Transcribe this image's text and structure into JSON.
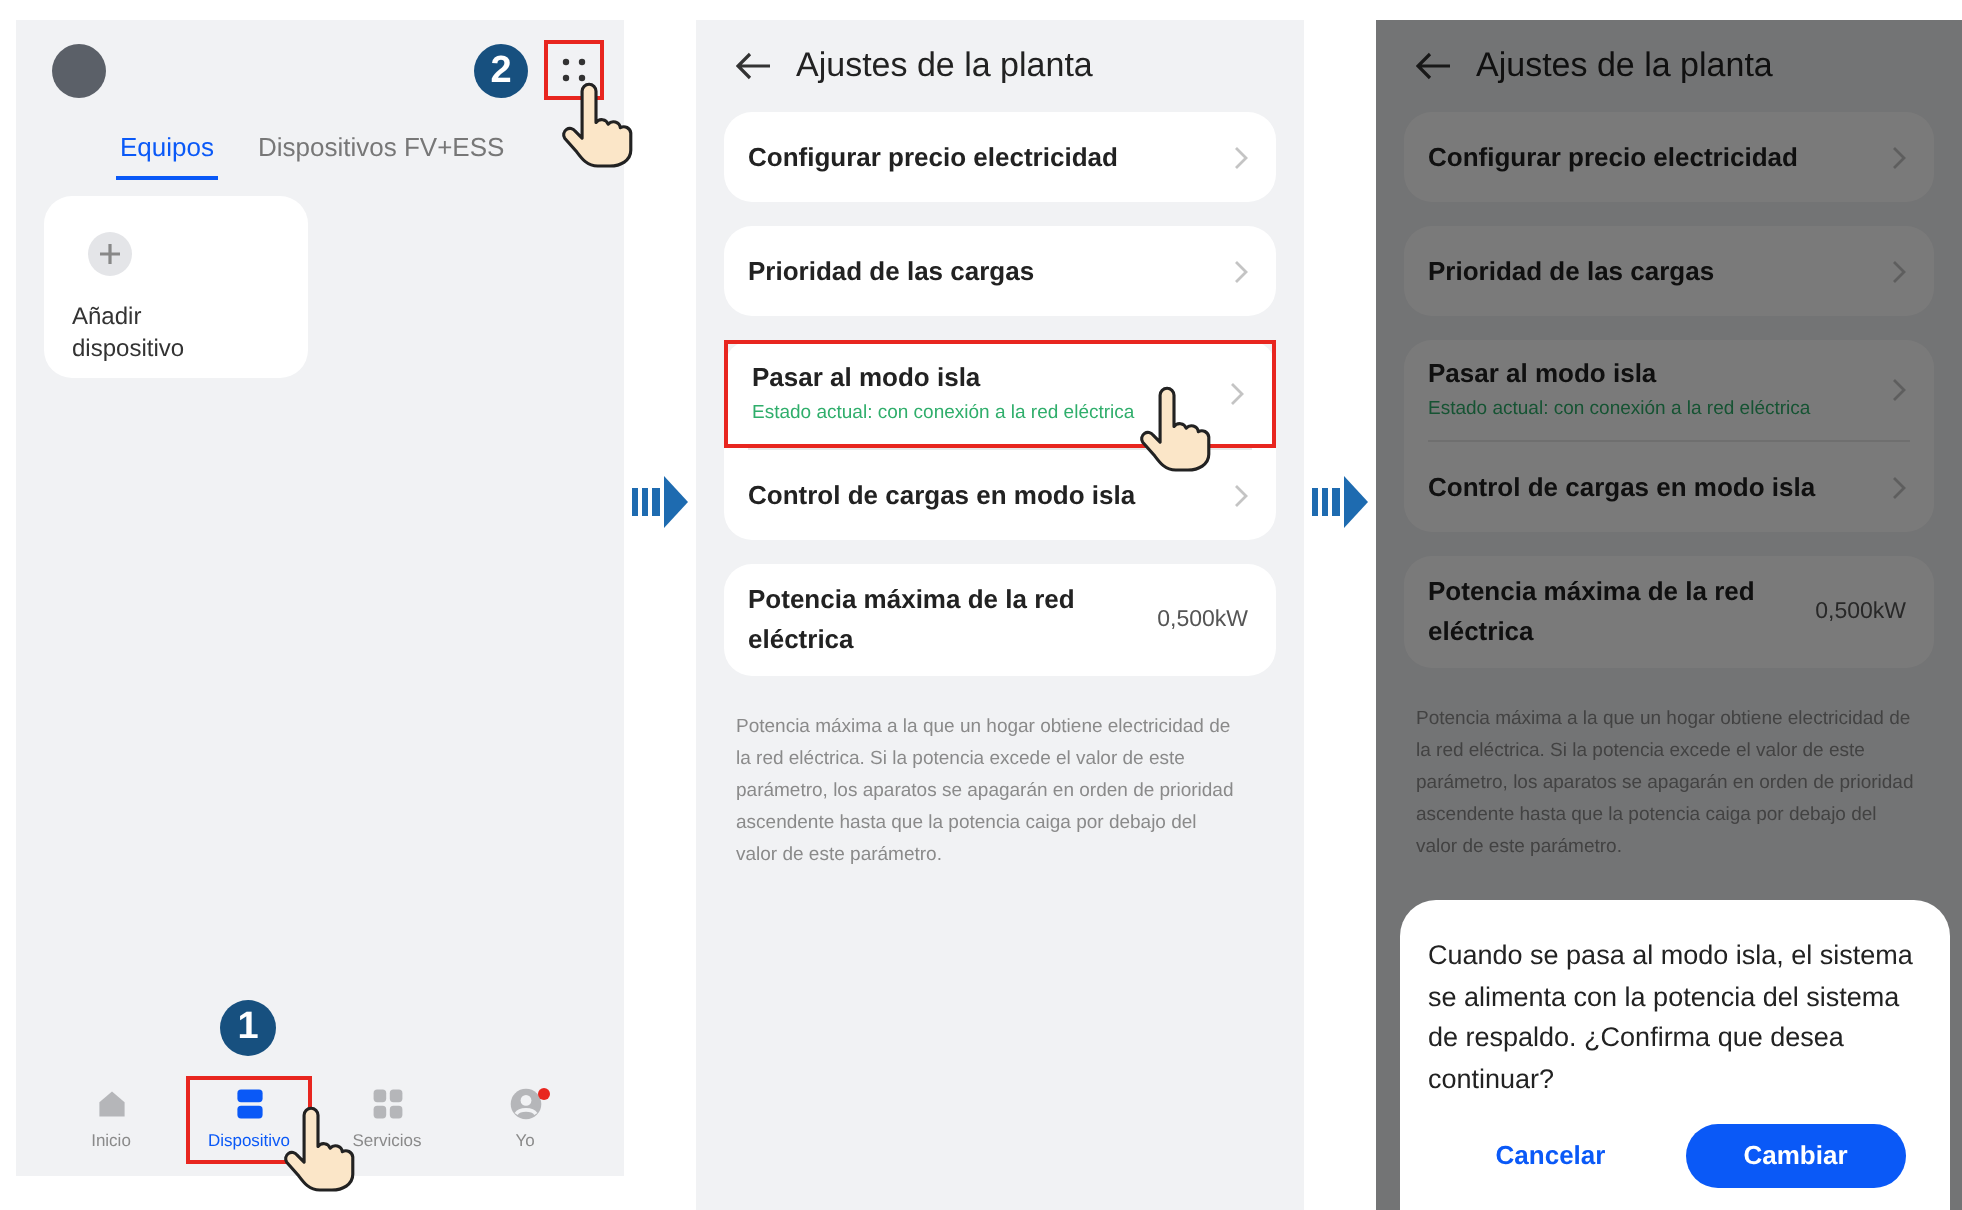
{
  "screens": [
    {
      "kind": "devices",
      "more": {
        "highlighted": true,
        "step": "2"
      },
      "tabs": [
        {
          "label": "Equipos",
          "selected": true
        },
        {
          "label": "Dispositivos FV+ESS",
          "selected": false
        }
      ],
      "add_card": {
        "label": "Añadir dispositivo"
      },
      "nav": [
        {
          "label": "Inicio",
          "kind": "home",
          "selected": false,
          "highlighted": false,
          "badge": false
        },
        {
          "label": "Dispositivo",
          "kind": "device",
          "selected": true,
          "highlighted": true,
          "badge": false,
          "step": "1"
        },
        {
          "label": "Servicios",
          "kind": "services",
          "selected": false,
          "highlighted": false,
          "badge": false
        },
        {
          "label": "Yo",
          "kind": "person",
          "selected": false,
          "highlighted": false,
          "badge": true
        }
      ]
    },
    {
      "kind": "settings",
      "dimmed": false,
      "title": "Ajustes de la planta",
      "groups": [
        {
          "rows": [
            {
              "label": "Configurar precio electricidad",
              "highlighted": false
            }
          ]
        },
        {
          "rows": [
            {
              "label": "Prioridad de las cargas",
              "highlighted": false
            }
          ]
        },
        {
          "rows": [
            {
              "label": "Pasar al modo isla",
              "status": "Estado actual: con conexión a la red eléctrica",
              "highlighted": true
            },
            {
              "label": "Control de cargas en modo isla",
              "highlighted": false
            }
          ]
        },
        {
          "rows": [
            {
              "label": "Potencia máxima de la red eléctrica",
              "value": "0,500kW",
              "highlighted": false
            }
          ]
        }
      ],
      "description": "Potencia máxima a la que un hogar obtiene electricidad de la red eléctrica. Si la potencia excede el valor de este parámetro, los aparatos se apagarán en orden de prioridad ascendente hasta que la potencia caiga por debajo del valor de este parámetro."
    },
    {
      "kind": "settings",
      "dimmed": true,
      "title": "Ajustes de la planta",
      "groups": [
        {
          "rows": [
            {
              "label": "Configurar precio electricidad",
              "highlighted": false
            }
          ]
        },
        {
          "rows": [
            {
              "label": "Prioridad de las cargas",
              "highlighted": false
            }
          ]
        },
        {
          "rows": [
            {
              "label": "Pasar al modo isla",
              "status": "Estado actual: con conexión a la red eléctrica",
              "highlighted": false
            },
            {
              "label": "Control de cargas en modo isla",
              "highlighted": false
            }
          ]
        },
        {
          "rows": [
            {
              "label": "Potencia máxima de la red eléctrica",
              "value": "0,500kW",
              "highlighted": false
            }
          ]
        }
      ],
      "description": "Potencia máxima a la que un hogar obtiene electricidad de la red eléctrica. Si la potencia excede el valor de este parámetro, los aparatos se apagarán en orden de prioridad ascendente hasta que la potencia caiga por debajo del valor de este parámetro.",
      "dialog": {
        "message": "Cuando se pasa al modo isla, el sistema se alimenta con la potencia del sistema de respaldo. ¿Confirma que desea continuar?",
        "buttons": [
          {
            "label": "Cancelar",
            "kind": "text"
          },
          {
            "label": "Cambiar",
            "kind": "primary"
          }
        ]
      }
    }
  ]
}
